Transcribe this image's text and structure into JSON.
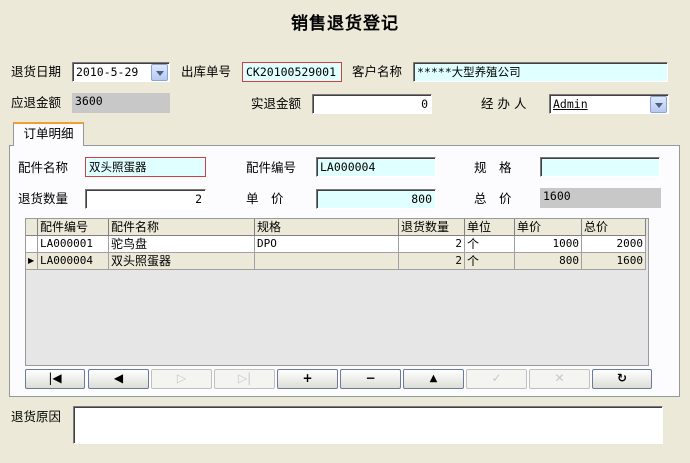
{
  "form": {
    "title": "销售退货登记"
  },
  "header": {
    "return_date_label": "退货日期",
    "return_date_value": "2010-5-29",
    "out_no_label": "出库单号",
    "out_no_value": "CK20100529001",
    "customer_label": "客户名称",
    "customer_value": "*****大型养殖公司",
    "due_amount_label": "应退金额",
    "due_amount_value": "3600",
    "actual_amount_label": "实退金额",
    "actual_amount_value": "0",
    "handler_label": "经 办 人",
    "handler_value": "Admin"
  },
  "tab": {
    "label": "订单明细"
  },
  "detail": {
    "part_name_label": "配件名称",
    "part_name_value": "双头照蛋器",
    "part_no_label": "配件编号",
    "part_no_value": "LA000004",
    "spec_label": "规　格",
    "spec_value": "",
    "qty_label": "退货数量",
    "qty_value": "2",
    "unit_price_label": "单　价",
    "unit_price_value": "800",
    "total_label": "总　价",
    "total_value": "1600"
  },
  "grid": {
    "columns": [
      "配件编号",
      "配件名称",
      "规格",
      "退货数量",
      "单位",
      "单价",
      "总价"
    ],
    "rows": [
      {
        "part_no": "LA000001",
        "part_name": "驼鸟盘",
        "spec": "DPO",
        "qty": "2",
        "unit": "个",
        "price": "1000",
        "total": "2000"
      },
      {
        "part_no": "LA000004",
        "part_name": "双头照蛋器",
        "spec": "",
        "qty": "2",
        "unit": "个",
        "price": "800",
        "total": "1600"
      }
    ]
  },
  "navigator": {
    "buttons": [
      {
        "icon": "first-record-icon",
        "glyph": "|◀",
        "enabled": true
      },
      {
        "icon": "prior-record-icon",
        "glyph": "◀",
        "enabled": true
      },
      {
        "icon": "next-record-icon",
        "glyph": "▷",
        "enabled": false
      },
      {
        "icon": "last-record-icon",
        "glyph": "▷|",
        "enabled": false
      },
      {
        "icon": "insert-record-icon",
        "glyph": "+",
        "enabled": true
      },
      {
        "icon": "delete-record-icon",
        "glyph": "−",
        "enabled": true
      },
      {
        "icon": "edit-record-icon",
        "glyph": "▲",
        "enabled": true
      },
      {
        "icon": "post-record-icon",
        "glyph": "✓",
        "enabled": false
      },
      {
        "icon": "cancel-record-icon",
        "glyph": "✕",
        "enabled": false
      },
      {
        "icon": "refresh-record-icon",
        "glyph": "↻",
        "enabled": true
      }
    ]
  },
  "footer": {
    "reason_label": "退货原因",
    "reason_value": ""
  },
  "colors": {
    "highlight_field": "#e0ffff",
    "readonly_field": "#c8c8c8",
    "window_bg": "#ece9d8"
  }
}
